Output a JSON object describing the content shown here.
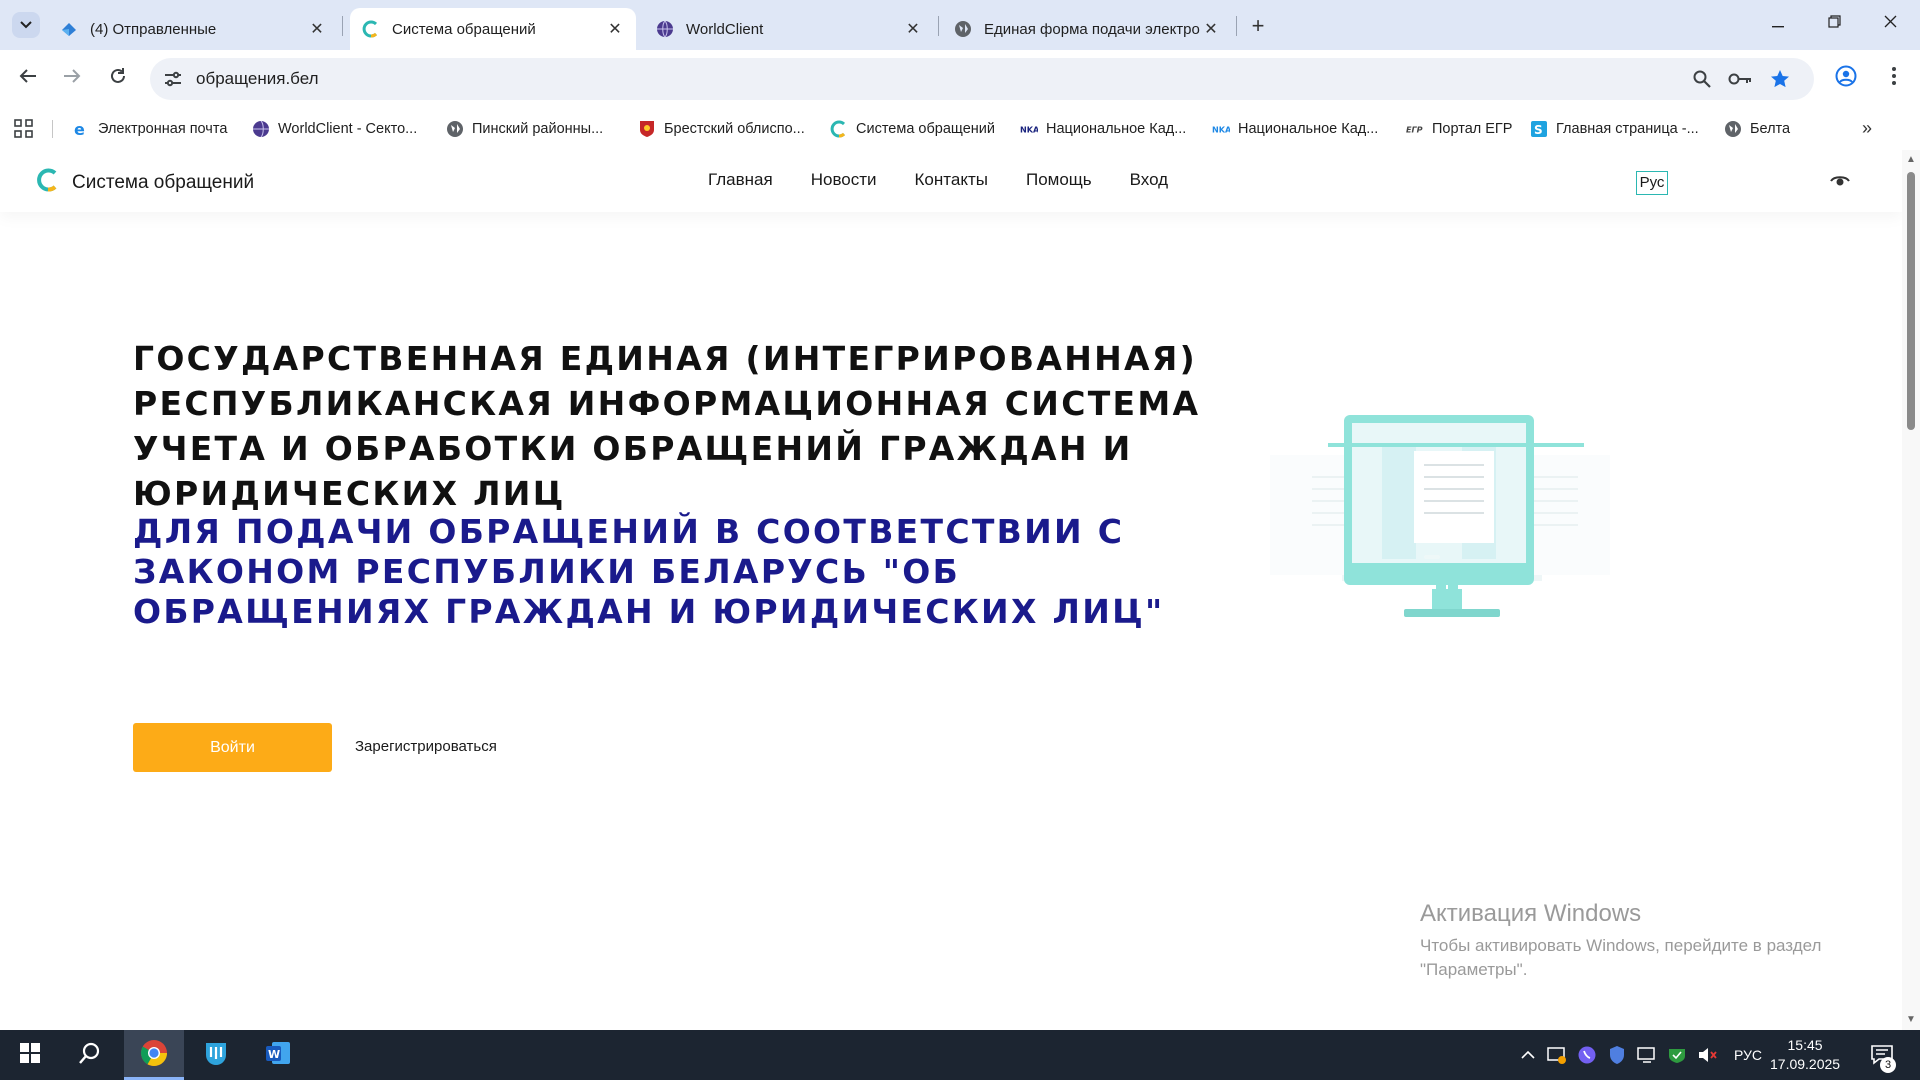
{
  "browser": {
    "tabs": [
      {
        "title": "(4) Отправленные",
        "active": false
      },
      {
        "title": "Система обращений",
        "active": true
      },
      {
        "title": "WorldClient",
        "active": false
      },
      {
        "title": "Единая форма подачи электро",
        "active": false
      }
    ],
    "url": "обращения.бел",
    "bookmarks": [
      "Электронная почта",
      "WorldClient - Секто...",
      "Пинский районны...",
      "Брестский облиспо...",
      "Система обращений",
      "Национальное Кад...",
      "Национальное Кад...",
      "Портал ЕГР",
      "Главная страница -...",
      "Белта"
    ],
    "accent_color": "#1a73e8"
  },
  "site": {
    "brand_name": "Система обращений",
    "menu": [
      "Главная",
      "Новости",
      "Контакты",
      "Помощь",
      "Вход"
    ],
    "lang": "Рус",
    "hero_title": "ГОСУДАРСТВЕННАЯ ЕДИНАЯ (ИНТЕГРИРОВАННАЯ) РЕСПУБЛИКАНСКАЯ ИНФОРМАЦИОННАЯ СИСТЕМА УЧЕТА И ОБРАБОТКИ ОБРАЩЕНИЙ ГРАЖДАН И ЮРИДИЧЕСКИХ ЛИЦ",
    "hero_subtitle": "ДЛЯ ПОДАЧИ ОБРАЩЕНИЙ В СООТВЕТСТВИИ С ЗАКОНОМ РЕСПУБЛИКИ БЕЛАРУСЬ \"ОБ ОБРАЩЕНИЯХ ГРАЖДАН И ЮРИДИЧЕСКИХ ЛИЦ\"",
    "login_button": "Войти",
    "register_link": "Зарегистрироваться",
    "button_color": "#fdab17",
    "subtitle_color": "#1a1a8c"
  },
  "watermark": {
    "title": "Активация Windows",
    "text": "Чтобы активировать Windows, перейдите в раздел \"Параметры\"."
  },
  "taskbar": {
    "lang": "РУС",
    "time": "15:45",
    "date": "17.09.2025",
    "notifications": "3"
  }
}
